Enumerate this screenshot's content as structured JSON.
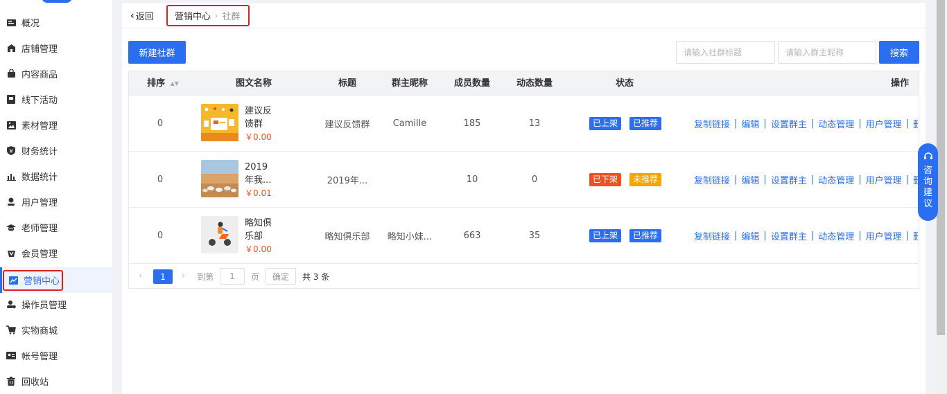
{
  "sidebar": {
    "items": [
      {
        "label": "概况",
        "icon": "dashboard-icon"
      },
      {
        "label": "店铺管理",
        "icon": "shop-icon"
      },
      {
        "label": "内容商品",
        "icon": "bag-icon"
      },
      {
        "label": "线下活动",
        "icon": "flag-icon"
      },
      {
        "label": "素材管理",
        "icon": "image-icon"
      },
      {
        "label": "财务统计",
        "icon": "yen-shield-icon"
      },
      {
        "label": "数据统计",
        "icon": "bar-chart-icon"
      },
      {
        "label": "用户管理",
        "icon": "user-icon"
      },
      {
        "label": "老师管理",
        "icon": "graduation-cap-icon"
      },
      {
        "label": "会员管理",
        "icon": "vip-icon"
      },
      {
        "label": "营销中心",
        "icon": "trend-icon"
      },
      {
        "label": "操作员管理",
        "icon": "operator-icon"
      },
      {
        "label": "实物商城",
        "icon": "cart-icon"
      },
      {
        "label": "帐号管理",
        "icon": "id-card-icon"
      },
      {
        "label": "回收站",
        "icon": "trash-icon"
      }
    ],
    "active_label": "营销中心"
  },
  "topbar": {
    "back_label": "返回",
    "breadcrumb": [
      "营销中心",
      "社群"
    ]
  },
  "toolbar": {
    "new_button": "新建社群",
    "search_title_placeholder": "请输入社群标题",
    "search_owner_placeholder": "请输入群主昵称",
    "search_button": "搜索"
  },
  "table": {
    "headers": {
      "order": "排序",
      "name": "图文名称",
      "title": "标题",
      "owner": "群主昵称",
      "members": "成员数量",
      "posts": "动态数量",
      "status": "状态",
      "actions": "操作"
    },
    "rows": [
      {
        "order": "0",
        "name_line1": "建议反",
        "name_line2": "馈群",
        "price": "￥0.00",
        "title": "建议反馈群",
        "owner": "Camille",
        "members": "185",
        "posts": "13",
        "status_shelf": "已上架",
        "status_rec": "已推荐",
        "shelf_color": "blue",
        "rec_color": "blue"
      },
      {
        "order": "0",
        "name_line1": "2019",
        "name_line2": "年我...",
        "price": "￥0.01",
        "title": "2019年...",
        "owner": "",
        "members": "10",
        "posts": "0",
        "status_shelf": "已下架",
        "status_rec": "未推荐",
        "shelf_color": "red",
        "rec_color": "yellow"
      },
      {
        "order": "0",
        "name_line1": "略知俱",
        "name_line2": "乐部",
        "price": "￥0.00",
        "title": "略知俱乐部",
        "owner": "略知小妹...",
        "members": "663",
        "posts": "35",
        "status_shelf": "已上架",
        "status_rec": "已推荐",
        "shelf_color": "blue",
        "rec_color": "blue"
      }
    ],
    "actions": [
      "复制链接",
      "编辑",
      "设置群主",
      "动态管理",
      "用户管理",
      "删除"
    ]
  },
  "pager": {
    "current": "1",
    "goto_label": "到第",
    "goto_value": "1",
    "page_label": "页",
    "confirm": "确定",
    "total": "共 3 条"
  },
  "consult": {
    "chars": [
      "咨",
      "询",
      "建",
      "议"
    ]
  },
  "colors": {
    "primary": "#2a6ff2",
    "highlight_border": "#e0201c",
    "price": "#f0501e",
    "tag_red": "#f0501e",
    "tag_yellow": "#f5a400"
  }
}
